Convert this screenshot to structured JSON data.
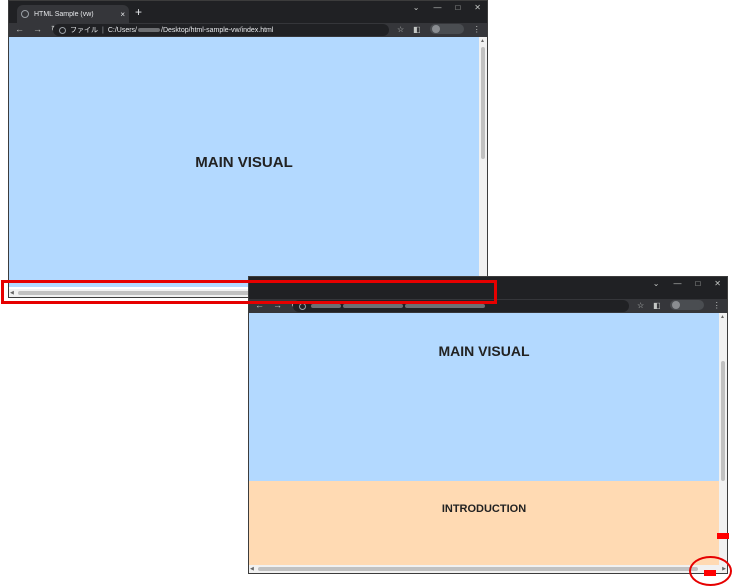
{
  "window1": {
    "tab_title": "HTML Sample (vw)",
    "tab_close": "×",
    "new_tab": "+",
    "file_label": "ファイル",
    "url_prefix": "C:/Users/",
    "url_suffix": "/Desktop/html-sample-vw/index.html",
    "main_visual": "MAIN VISUAL"
  },
  "window2": {
    "main_visual": "MAIN VISUAL",
    "introduction": "INTRODUCTION"
  },
  "colors": {
    "main_visual_bg": "#b3d9ff",
    "introduction_bg": "#ffdab3",
    "highlight": "#e60000"
  }
}
